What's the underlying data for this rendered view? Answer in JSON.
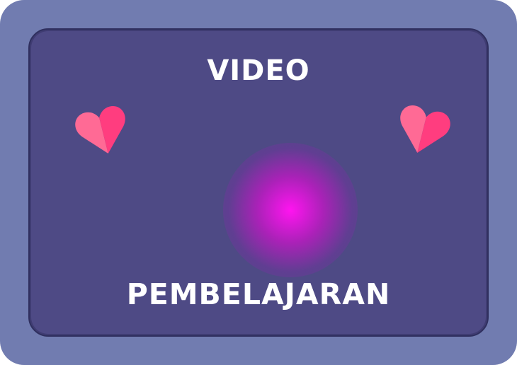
{
  "colors": {
    "frame": "#717cb0",
    "screen": "#4e4a85",
    "glow_center": "#ff14f0",
    "heart_light": "#ff6a95",
    "heart_dark": "#ff3d7f",
    "text": "#ffffff"
  },
  "card": {
    "title_top": "VIDEO",
    "title_bottom": "PEMBELAJARAN"
  },
  "icons": {
    "left": "heart-icon",
    "right": "heart-icon"
  }
}
